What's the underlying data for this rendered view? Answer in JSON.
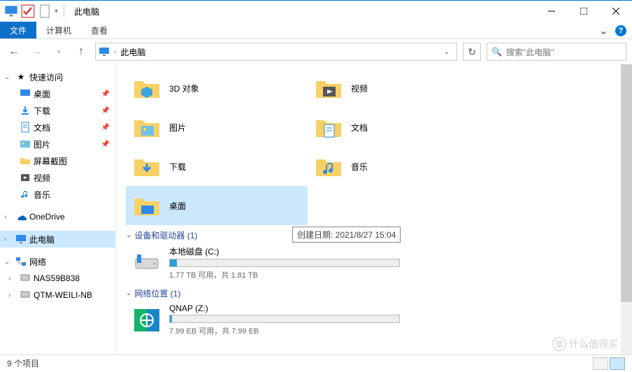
{
  "title": "此电脑",
  "ribbon": {
    "file": "文件",
    "computer": "计算机",
    "view": "查看"
  },
  "address": {
    "location": "此电脑"
  },
  "search": {
    "placeholder": "搜索\"此电脑\""
  },
  "sidebar": {
    "quick": "快速访问",
    "desktop": "桌面",
    "downloads": "下载",
    "documents": "文档",
    "pictures": "图片",
    "screenshots": "屏幕截图",
    "videos": "视频",
    "music": "音乐",
    "onedrive": "OneDrive",
    "thispc": "此电脑",
    "network": "网络",
    "nas": "NAS59B838",
    "qtm": "QTM-WEILI-NB"
  },
  "folders": {
    "3d": "3D 对象",
    "videos": "视频",
    "pictures": "图片",
    "documents": "文档",
    "downloads": "下载",
    "music": "音乐",
    "desktop": "桌面"
  },
  "sections": {
    "devices": "设备和驱动器 (1)",
    "network": "网络位置 (1)"
  },
  "drives": {
    "local": {
      "name": "本地磁盘 (C:)",
      "sub": "1.77 TB 可用，共 1.81 TB",
      "fill": 3
    },
    "qnap": {
      "name": "QNAP (Z:)",
      "sub": "7.99 EB 可用，共 7.99 EB",
      "fill": 1
    }
  },
  "tooltip": "创建日期: 2021/8/27 15:04",
  "status": "9 个项目",
  "watermark": "什么值得买"
}
